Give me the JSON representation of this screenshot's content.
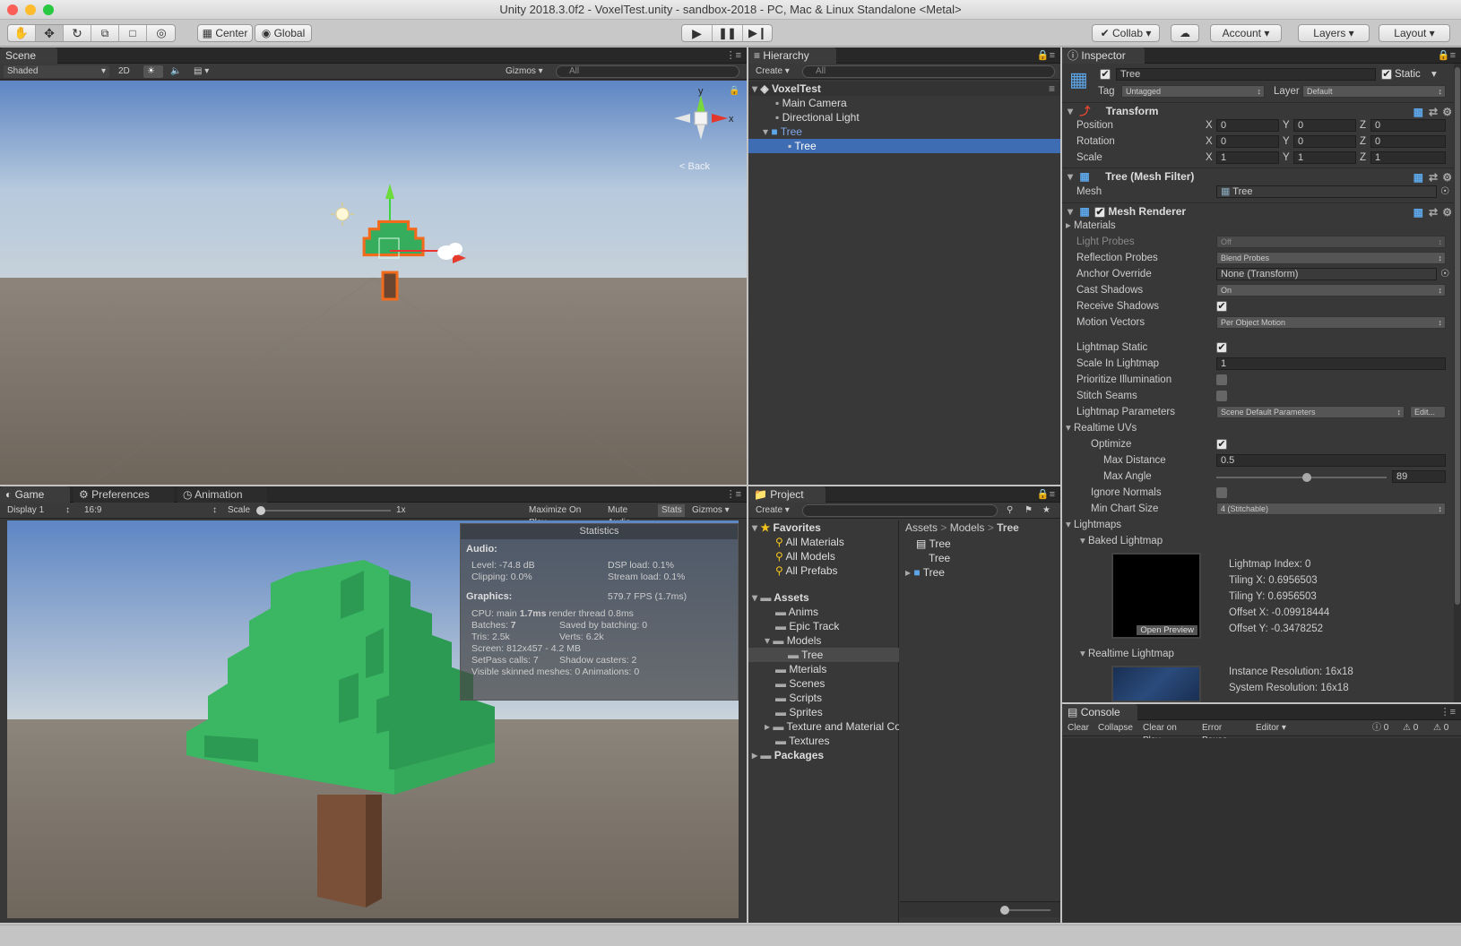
{
  "window": {
    "title": "Unity 2018.3.0f2 - VoxelTest.unity - sandbox-2018 - PC, Mac & Linux Standalone <Metal>"
  },
  "toolbar": {
    "tools": [
      "hand-icon",
      "move-icon",
      "rotate-icon",
      "scale-icon",
      "rect-icon",
      "transform-icon"
    ],
    "pivot_label": "Center",
    "space_label": "Global",
    "collab_label": "Collab",
    "account_label": "Account",
    "layers_label": "Layers",
    "layout_label": "Layout"
  },
  "scene": {
    "tab": "Scene",
    "draw_mode": "Shaded",
    "mode_2d": "2D",
    "gizmos": "Gizmos",
    "search_placeholder": "All",
    "gizmo_back": "Back"
  },
  "game": {
    "tabs": [
      "Game",
      "Preferences",
      "Animation"
    ],
    "display": "Display 1",
    "aspect": "16:9",
    "scale_label": "Scale",
    "scale_value": "1x",
    "maximize": "Maximize On Play",
    "mute": "Mute Audio",
    "stats": "Stats",
    "gizmos": "Gizmos",
    "statistics": {
      "title": "Statistics",
      "audio_label": "Audio:",
      "level": "Level: -74.8 dB",
      "dsp": "DSP load: 0.1%",
      "clipping": "Clipping: 0.0%",
      "stream": "Stream load: 0.1%",
      "graphics_label": "Graphics:",
      "fps": "579.7 FPS (1.7ms)",
      "cpu_prefix": "CPU: main ",
      "cpu_bold": "1.7ms",
      "cpu_suffix": "  render thread 0.8ms",
      "batches_prefix": "Batches: ",
      "batches_value": "7",
      "saved": "Saved by batching: 0",
      "tris": "Tris: 2.5k",
      "verts": "Verts: 6.2k",
      "screen": "Screen: 812x457 - 4.2 MB",
      "setpass": "SetPass calls: 7",
      "shadow": "Shadow casters: 2",
      "visible": "Visible skinned meshes: 0  Animations: 0"
    }
  },
  "hierarchy": {
    "tab": "Hierarchy",
    "create": "Create",
    "search_placeholder": "All",
    "scene_name": "VoxelTest",
    "items": [
      "Main Camera",
      "Directional Light",
      "Tree",
      "Tree"
    ]
  },
  "project": {
    "tab": "Project",
    "create": "Create",
    "favorites_label": "Favorites",
    "favorites": [
      "All Materials",
      "All Models",
      "All Prefabs"
    ],
    "assets_label": "Assets",
    "folders": [
      "Anims",
      "Epic Track",
      "Models",
      "Tree",
      "Mterials",
      "Scenes",
      "Scripts",
      "Sprites",
      "Texture and Material Co",
      "Textures"
    ],
    "packages_label": "Packages",
    "breadcrumb": [
      "Assets",
      "Models",
      "Tree"
    ],
    "files": [
      "Tree",
      "Tree",
      "Tree"
    ]
  },
  "inspector": {
    "tab": "Inspector",
    "object_name": "Tree",
    "static_label": "Static",
    "tag_label": "Tag",
    "tag_value": "Untagged",
    "layer_label": "Layer",
    "layer_value": "Default",
    "transform": {
      "title": "Transform",
      "position_label": "Position",
      "rotation_label": "Rotation",
      "scale_label": "Scale",
      "axis_x": "X",
      "axis_y": "Y",
      "axis_z": "Z",
      "position": [
        "0",
        "0",
        "0"
      ],
      "rotation": [
        "0",
        "0",
        "0"
      ],
      "scale": [
        "1",
        "1",
        "1"
      ]
    },
    "mesh_filter": {
      "title": "Tree (Mesh Filter)",
      "mesh_label": "Mesh",
      "mesh_value": "Tree"
    },
    "mesh_renderer": {
      "title": "Mesh Renderer",
      "materials": "Materials",
      "light_probes": "Light Probes",
      "light_probes_value": "Off",
      "reflection_probes": "Reflection Probes",
      "reflection_probes_value": "Blend Probes",
      "anchor_override": "Anchor Override",
      "anchor_override_value": "None (Transform)",
      "cast_shadows": "Cast Shadows",
      "cast_shadows_value": "On",
      "receive_shadows": "Receive Shadows",
      "motion_vectors": "Motion Vectors",
      "motion_vectors_value": "Per Object Motion",
      "lightmap_static": "Lightmap Static",
      "scale_in_lightmap": "Scale In Lightmap",
      "scale_in_lightmap_value": "1",
      "prioritize": "Prioritize Illumination",
      "stitch": "Stitch Seams",
      "lightmap_params": "Lightmap Parameters",
      "lightmap_params_value": "Scene Default Parameters",
      "edit": "Edit...",
      "realtime_uvs": "Realtime UVs",
      "optimize": "Optimize",
      "max_distance": "Max Distance",
      "max_distance_value": "0.5",
      "max_angle": "Max Angle",
      "max_angle_value": "89",
      "ignore_normals": "Ignore Normals",
      "min_chart": "Min Chart Size",
      "min_chart_value": "4 (Stitchable)",
      "lightmaps": "Lightmaps",
      "baked": "Baked Lightmap",
      "open_preview": "Open Preview",
      "lightmap_index": "Lightmap Index: 0",
      "tiling_x": "Tiling X: 0.6956503",
      "tiling_y": "Tiling Y: 0.6956503",
      "offset_x": "Offset X: -0.09918444",
      "offset_y": "Offset Y: -0.3478252",
      "realtime": "Realtime Lightmap",
      "instance_res": "Instance Resolution: 16x18",
      "system_res": "System Resolution: 16x18"
    }
  },
  "console": {
    "tab": "Console",
    "buttons": [
      "Clear",
      "Collapse",
      "Clear on Play",
      "Error Pause",
      "Editor"
    ],
    "counts": [
      "0",
      "0",
      "0"
    ]
  },
  "colors": {
    "selection": "#3e6db4",
    "tree_green": "#35ad5c",
    "trunk": "#7a5038",
    "highlight_orange": "#f26b1d"
  }
}
